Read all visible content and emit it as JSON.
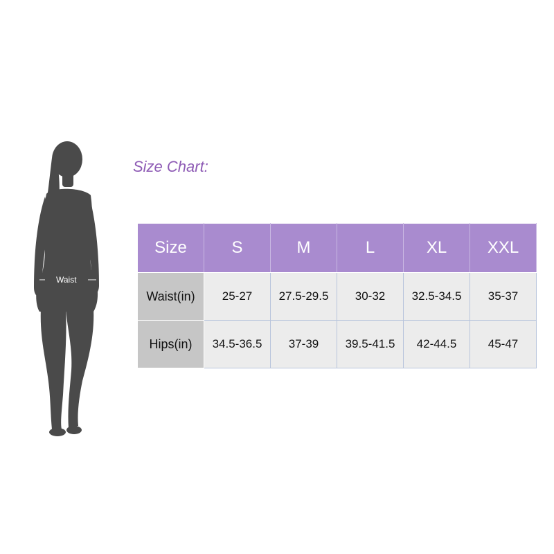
{
  "title": "Size Chart:",
  "figure": {
    "waist_label": "Waist"
  },
  "table": {
    "headers": [
      "Size",
      "S",
      "M",
      "L",
      "XL",
      "XXL"
    ],
    "rows": [
      {
        "label": "Waist(in)",
        "values": [
          "25-27",
          "27.5-29.5",
          "30-32",
          "32.5-34.5",
          "35-37"
        ]
      },
      {
        "label": "Hips(in)",
        "values": [
          "34.5-36.5",
          "37-39",
          "39.5-41.5",
          "42-44.5",
          "45-47"
        ]
      }
    ]
  },
  "colors": {
    "accent": "#a98bcf",
    "title": "#8e5bb5",
    "row_header": "#c6c6c6",
    "cell": "#ececec",
    "silhouette": "#4a4a4a"
  }
}
